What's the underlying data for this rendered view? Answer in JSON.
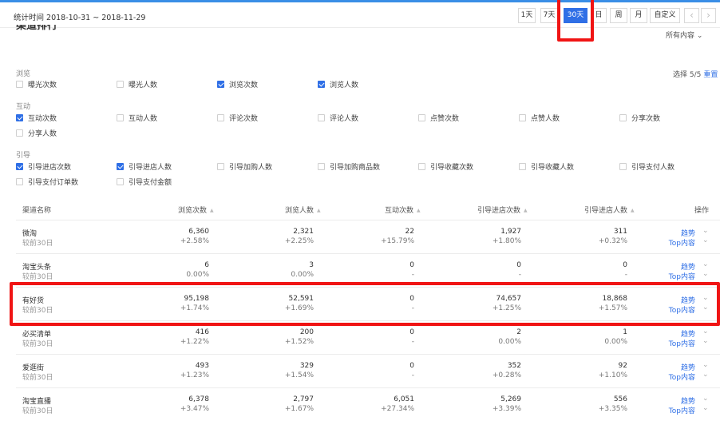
{
  "header": {
    "stat_time": "统计时间 2018-10-31 ~ 2018-11-29",
    "ranges": [
      "1天",
      "7天",
      "30天",
      "日",
      "周",
      "月",
      "自定义"
    ],
    "active_range": "30天",
    "prev_icon": "chevron-left-icon",
    "next_icon": "chevron-right-icon"
  },
  "section": {
    "title": "渠道排行",
    "filter": "所有内容",
    "select_count": "选择 5/5",
    "reset": "重置"
  },
  "metric_groups": [
    {
      "label": "浏览",
      "items": [
        {
          "label": "曝光次数",
          "checked": false
        },
        {
          "label": "曝光人数",
          "checked": false
        },
        {
          "label": "浏览次数",
          "checked": true
        },
        {
          "label": "浏览人数",
          "checked": true
        }
      ]
    },
    {
      "label": "互动",
      "items": [
        {
          "label": "互动次数",
          "checked": true
        },
        {
          "label": "互动人数",
          "checked": false
        },
        {
          "label": "评论次数",
          "checked": false
        },
        {
          "label": "评论人数",
          "checked": false
        },
        {
          "label": "点赞次数",
          "checked": false
        },
        {
          "label": "点赞人数",
          "checked": false
        },
        {
          "label": "分享次数",
          "checked": false
        },
        {
          "label": "分享人数",
          "checked": false
        }
      ]
    },
    {
      "label": "引导",
      "items": [
        {
          "label": "引导进店次数",
          "checked": true
        },
        {
          "label": "引导进店人数",
          "checked": true
        },
        {
          "label": "引导加购人数",
          "checked": false
        },
        {
          "label": "引导加购商品数",
          "checked": false
        },
        {
          "label": "引导收藏次数",
          "checked": false
        },
        {
          "label": "引导收藏人数",
          "checked": false
        },
        {
          "label": "引导支付人数",
          "checked": false
        },
        {
          "label": "引导支付订单数",
          "checked": false
        },
        {
          "label": "引导支付金额",
          "checked": false
        }
      ]
    }
  ],
  "table": {
    "columns": [
      "渠道名称",
      "浏览次数",
      "浏览人数",
      "互动次数",
      "引导进店次数",
      "引导进店人数",
      "操作"
    ],
    "compare_label": "较前30日",
    "action_trend": "趋势",
    "action_top": "Top内容",
    "rows": [
      {
        "name": "微淘",
        "values": [
          "6,360",
          "2,321",
          "22",
          "1,927",
          "311"
        ],
        "changes": [
          "+2.58%",
          "+2.25%",
          "+15.79%",
          "+1.80%",
          "+0.32%"
        ]
      },
      {
        "name": "淘宝头条",
        "values": [
          "6",
          "3",
          "0",
          "0",
          "0"
        ],
        "changes": [
          "0.00%",
          "0.00%",
          "-",
          "-",
          "-"
        ]
      },
      {
        "name": "有好货",
        "values": [
          "95,198",
          "52,591",
          "0",
          "74,657",
          "18,868"
        ],
        "changes": [
          "+1.74%",
          "+1.69%",
          "-",
          "+1.25%",
          "+1.57%"
        ]
      },
      {
        "name": "必买清单",
        "values": [
          "416",
          "200",
          "0",
          "2",
          "1"
        ],
        "changes": [
          "+1.22%",
          "+1.52%",
          "-",
          "0.00%",
          "0.00%"
        ]
      },
      {
        "name": "爱逛街",
        "values": [
          "493",
          "329",
          "0",
          "352",
          "92"
        ],
        "changes": [
          "+1.23%",
          "+1.54%",
          "-",
          "+0.28%",
          "+1.10%"
        ]
      },
      {
        "name": "淘宝直播",
        "values": [
          "6,378",
          "2,797",
          "6,051",
          "5,269",
          "556"
        ],
        "changes": [
          "+3.47%",
          "+1.67%",
          "+27.34%",
          "+3.39%",
          "+3.35%"
        ]
      }
    ]
  }
}
